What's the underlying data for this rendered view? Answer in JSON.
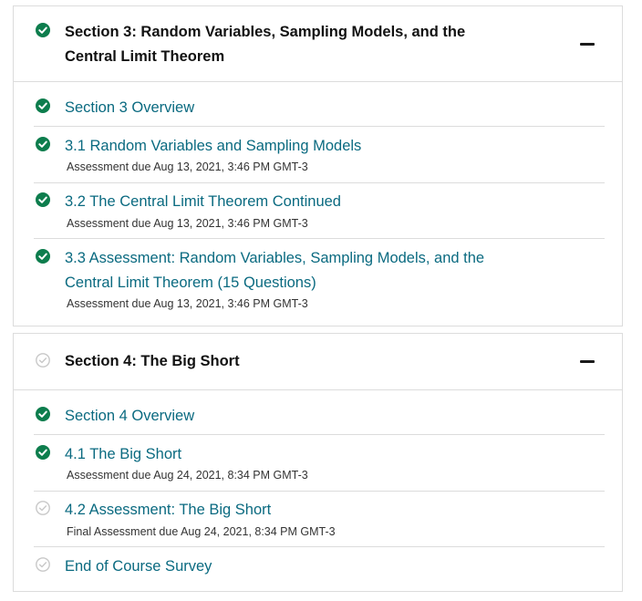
{
  "sections": [
    {
      "title_line1": "Section 3: Random Variables, Sampling Models, and the",
      "title_line2": "Central Limit Theorem",
      "status_icon": "check-circle-icon",
      "collapse_icon": "minus-icon",
      "units": [
        {
          "title": "Section 3 Overview",
          "status_icon": "check-circle-icon"
        },
        {
          "title": "3.1 Random Variables and Sampling Models",
          "due": "Assessment due Aug 13, 2021, 3:46 PM GMT-3",
          "status_icon": "check-circle-icon"
        },
        {
          "title": "3.2 The Central Limit Theorem Continued",
          "due": "Assessment due Aug 13, 2021, 3:46 PM GMT-3",
          "status_icon": "check-circle-icon"
        },
        {
          "title_line1": "3.3 Assessment: Random Variables, Sampling Models, and the",
          "title_line2": "Central Limit Theorem (15 Questions)",
          "due": "Assessment due Aug 13, 2021, 3:46 PM GMT-3",
          "status_icon": "check-circle-icon"
        }
      ]
    },
    {
      "title": "Section 4: The Big Short",
      "status_icon": "incomplete-check-icon",
      "collapse_icon": "minus-icon",
      "units": [
        {
          "title": "Section 4 Overview",
          "status_icon": "check-circle-icon"
        },
        {
          "title": "4.1 The Big Short",
          "due": "Assessment due Aug 24, 2021, 8:34 PM GMT-3",
          "status_icon": "check-circle-icon"
        },
        {
          "title": "4.2 Assessment: The Big Short",
          "due": "Final Assessment due Aug 24, 2021, 8:34 PM GMT-3",
          "status_icon": "incomplete-check-icon"
        },
        {
          "title": "End of Course Survey",
          "status_icon": "incomplete-check-icon"
        }
      ]
    }
  ],
  "colors": {
    "complete": "#0d7d4d",
    "incomplete": "#c8c8c8",
    "link": "#0a6a80",
    "border": "#dcdcdc"
  }
}
